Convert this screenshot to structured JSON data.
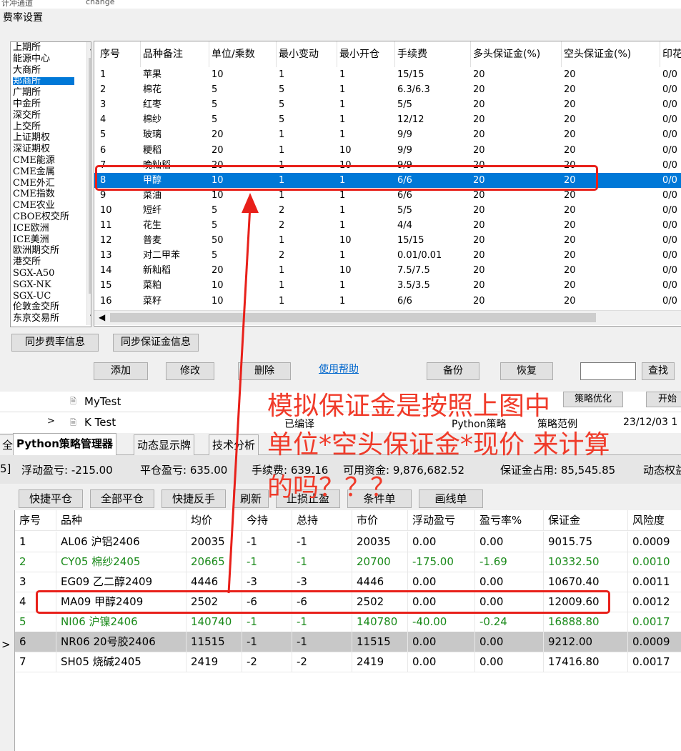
{
  "top_strip": {
    "left_text": "计冲通道",
    "right_text": "change"
  },
  "dialog": {
    "title": "费率设置",
    "exchanges": [
      "上期所",
      "能源中心",
      "大商所",
      "郑商所",
      "广期所",
      "中金所",
      "深交所",
      "上交所",
      "上证期权",
      "深证期权",
      "CME能源",
      "CME金属",
      "CME外汇",
      "CME指数",
      "CME农业",
      "CBOE权交所",
      "ICE欧洲",
      "ICE美洲",
      "欧洲期交所",
      "港交所",
      "SGX-A50",
      "SGX-NK",
      "SGX-UC",
      "伦敦金交所",
      "东京交易所"
    ],
    "selected_exchange": 3,
    "columns": [
      "序号",
      "品种备注",
      "单位/乘数",
      "最小变动",
      "最小开仓",
      "手续费",
      "多头保证金(%)",
      "空头保证金(%)",
      "印花"
    ],
    "rows": [
      [
        "1",
        "苹果",
        "10",
        "1",
        "1",
        "15/15",
        "20",
        "20",
        "0/0"
      ],
      [
        "2",
        "棉花",
        "5",
        "5",
        "1",
        "6.3/6.3",
        "20",
        "20",
        "0/0"
      ],
      [
        "3",
        "红枣",
        "5",
        "5",
        "1",
        "5/5",
        "20",
        "20",
        "0/0"
      ],
      [
        "4",
        "棉纱",
        "5",
        "5",
        "1",
        "12/12",
        "20",
        "20",
        "0/0"
      ],
      [
        "5",
        "玻璃",
        "20",
        "1",
        "1",
        "9/9",
        "20",
        "20",
        "0/0"
      ],
      [
        "6",
        "粳稻",
        "20",
        "1",
        "10",
        "9/9",
        "20",
        "20",
        "0/0"
      ],
      [
        "7",
        "晚籼稻",
        "20",
        "1",
        "10",
        "9/9",
        "20",
        "20",
        "0/0"
      ],
      [
        "8",
        "甲醇",
        "10",
        "1",
        "1",
        "6/6",
        "20",
        "20",
        "0/0"
      ],
      [
        "9",
        "菜油",
        "10",
        "1",
        "1",
        "6/6",
        "20",
        "20",
        "0/0"
      ],
      [
        "10",
        "短纤",
        "5",
        "2",
        "1",
        "5/5",
        "20",
        "20",
        "0/0"
      ],
      [
        "11",
        "花生",
        "5",
        "2",
        "1",
        "4/4",
        "20",
        "20",
        "0/0"
      ],
      [
        "12",
        "普麦",
        "50",
        "1",
        "10",
        "15/15",
        "20",
        "20",
        "0/0"
      ],
      [
        "13",
        "对二甲苯",
        "5",
        "2",
        "1",
        "0.01/0.01",
        "20",
        "20",
        "0/0"
      ],
      [
        "14",
        "新籼稻",
        "20",
        "1",
        "10",
        "7.5/7.5",
        "20",
        "20",
        "0/0"
      ],
      [
        "15",
        "菜粕",
        "10",
        "1",
        "1",
        "3.5/3.5",
        "20",
        "20",
        "0/0"
      ],
      [
        "16",
        "菜籽",
        "10",
        "1",
        "1",
        "6/6",
        "20",
        "20",
        "0/0"
      ]
    ],
    "selected_row": 7,
    "buttons": {
      "sync_fee": "同步费率信息",
      "sync_margin": "同步保证金信息",
      "add": "添加",
      "edit": "修改",
      "delete": "删除",
      "help": "使用帮助",
      "backup": "备份",
      "restore": "恢复",
      "search": "查找"
    }
  },
  "middle": {
    "row1_name": "MyTest",
    "row1_right1": "策略优化",
    "row1_right2": "开始",
    "row2_name": "K Test",
    "row2_status": "已编译",
    "row2_type": "Python策略",
    "row2_category": "策略范例",
    "row2_time": "23/12/03 1"
  },
  "tabs": [
    "全",
    "Python策略管理器",
    "动态显示牌",
    "技术分析"
  ],
  "summary": {
    "prefix": "5]",
    "float_pl": "浮动盈亏: -215.00",
    "close_pl": "平仓盈亏: 635.00",
    "fee": "手续费: 639.16",
    "available": "可用资金: 9,876,682.52",
    "margin_used": "保证金占用: 85,545.85",
    "dynamic": "动态权益"
  },
  "toolbar2": [
    "快捷平仓",
    "全部平仓",
    "快捷反手",
    "刷新",
    "止损止盈",
    "条件单",
    "画线单"
  ],
  "positions": {
    "columns": [
      "序号",
      "品种",
      "均价",
      "今持",
      "总持",
      "市价",
      "浮动盈亏",
      "盈亏率%",
      "保证金",
      "风险度"
    ],
    "rows": [
      [
        "1",
        "AL06 沪铝2406",
        "20035",
        "-1",
        "-1",
        "20035",
        "0.00",
        "0.00",
        "9015.75",
        "0.0009"
      ],
      [
        "2",
        "CY05 棉纱2405",
        "20665",
        "-1",
        "-1",
        "20700",
        "-175.00",
        "-1.69",
        "10332.50",
        "0.0010"
      ],
      [
        "3",
        "EG09 乙二醇2409",
        "4446",
        "-3",
        "-3",
        "4446",
        "0.00",
        "0.00",
        "10670.40",
        "0.0011"
      ],
      [
        "4",
        "MA09 甲醇2409",
        "2502",
        "-6",
        "-6",
        "2502",
        "0.00",
        "0.00",
        "12009.60",
        "0.0012"
      ],
      [
        "5",
        "NI06 沪镍2406",
        "140740",
        "-1",
        "-1",
        "140780",
        "-40.00",
        "-0.24",
        "16888.80",
        "0.0017"
      ],
      [
        "6",
        "NR06 20号胶2406",
        "11515",
        "-1",
        "-1",
        "11515",
        "0.00",
        "0.00",
        "9212.00",
        "0.0009"
      ],
      [
        "7",
        "SH05 烧碱2405",
        "2419",
        "-2",
        "-2",
        "2419",
        "0.00",
        "0.00",
        "17416.80",
        "0.0017"
      ]
    ],
    "green_rows": [
      1,
      4
    ],
    "gray_row": 5
  },
  "annotation": {
    "line1": "模拟保证金是按照上图中",
    "line2": "单位*空头保证金*现价  来计算",
    "line3": "的吗？？？"
  },
  "colors": {
    "highlight": "#e8201a",
    "selection": "#0078d7",
    "green_text": "#1a8a1a"
  }
}
